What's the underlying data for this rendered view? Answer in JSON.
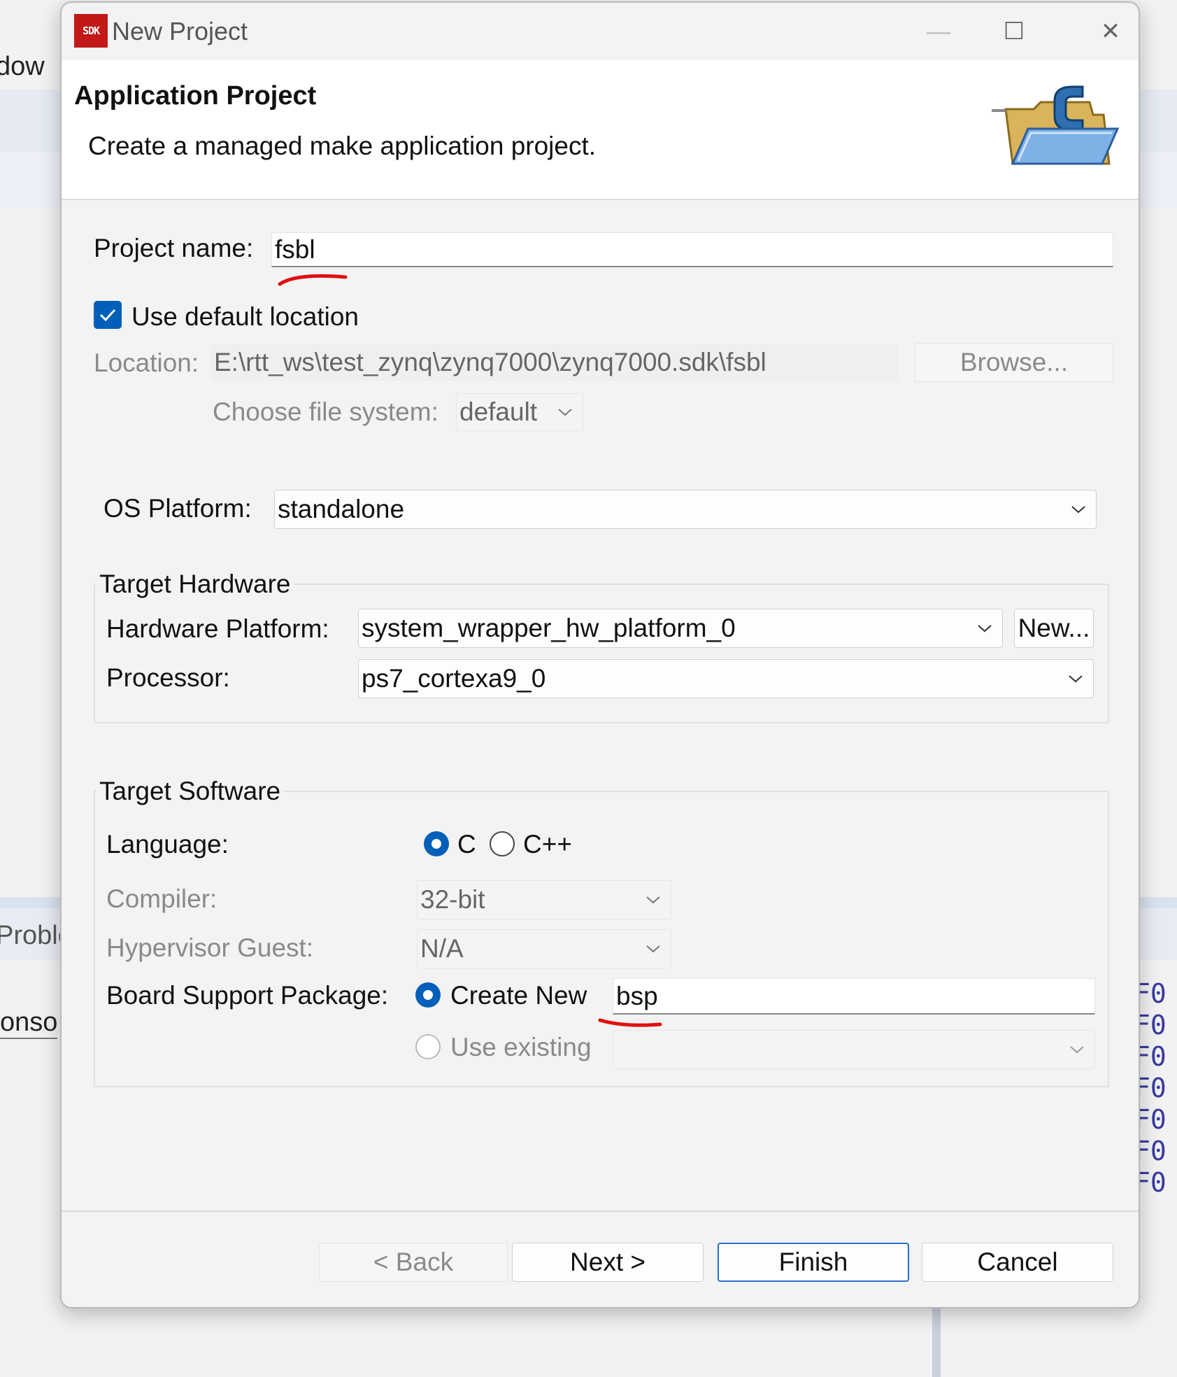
{
  "background": {
    "menu_fragment": "dow",
    "tab_fragment": "Proble",
    "console_fragment": "onso",
    "console_lines": [
      "F0",
      "F0",
      "F0",
      "F0",
      "F0",
      "F0",
      "F0"
    ]
  },
  "window": {
    "app_icon_text": "SDK",
    "title": "New Project",
    "minimize_symbol": "—",
    "maximize_symbol": "☐",
    "close_symbol": "✕"
  },
  "header": {
    "title": "Application Project",
    "description": "Create a managed make application project.",
    "icon": "folder-c-icon"
  },
  "project": {
    "name_label": "Project name:",
    "name_value": "fsbl",
    "use_default_label": "Use default location",
    "use_default_checked": true,
    "location_label": "Location:",
    "location_value": "E:\\rtt_ws\\test_zynq\\zynq7000\\zynq7000.sdk\\fsbl",
    "browse_label": "Browse...",
    "filesystem_label": "Choose file system:",
    "filesystem_value": "default"
  },
  "os": {
    "label": "OS Platform:",
    "value": "standalone"
  },
  "target_hardware": {
    "group_title": "Target Hardware",
    "platform_label": "Hardware Platform:",
    "platform_value": "system_wrapper_hw_platform_0",
    "new_label": "New...",
    "processor_label": "Processor:",
    "processor_value": "ps7_cortexa9_0"
  },
  "target_software": {
    "group_title": "Target Software",
    "language_label": "Language:",
    "lang_c": "C",
    "lang_cpp": "C++",
    "selected_language": "C",
    "compiler_label": "Compiler:",
    "compiler_value": "32-bit",
    "hypervisor_label": "Hypervisor Guest:",
    "hypervisor_value": "N/A",
    "bsp_label": "Board Support Package:",
    "create_new_label": "Create New",
    "bsp_value": "bsp",
    "use_existing_label": "Use existing",
    "use_existing_value": ""
  },
  "buttons": {
    "back": "< Back",
    "next": "Next >",
    "finish": "Finish",
    "cancel": "Cancel"
  },
  "colors": {
    "accent": "#005fb8",
    "annotation": "#e01010"
  }
}
